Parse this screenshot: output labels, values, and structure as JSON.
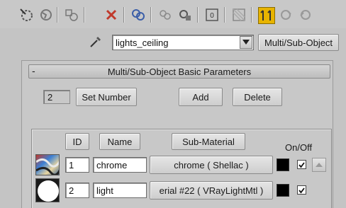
{
  "toolbar": {
    "icons": [
      "pick-material-icon",
      "get-material-icon",
      "put-to-scene-icon",
      "delete-icon",
      "assign-to-selection-icon",
      "make-unique-icon",
      "put-to-library-icon",
      "material-id-channel-icon",
      "show-map-icon",
      "show-background-icon",
      "go-to-parent-icon",
      "go-forward-icon",
      "go-sibling-icon"
    ],
    "accent": "#c0392b",
    "active_color": "#e8b400"
  },
  "material": {
    "name_value": "lights_ceiling",
    "type_label": "Multi/Sub-Object"
  },
  "rollout": {
    "title": "Multi/Sub-Object Basic Parameters",
    "collapse_glyph": "-",
    "count_value": "2",
    "set_number_label": "Set Number",
    "add_label": "Add",
    "delete_label": "Delete"
  },
  "table": {
    "headers": {
      "id": "ID",
      "name": "Name",
      "sub_material": "Sub-Material",
      "on_off": "On/Off"
    },
    "rows": [
      {
        "id": "1",
        "name": "chrome",
        "sub_material": "chrome  ( Shellac )",
        "color": "#000000",
        "on": true
      },
      {
        "id": "2",
        "name": "light",
        "sub_material": "erial #22  ( VRayLightMtl )",
        "color": "#000000",
        "on": true
      }
    ]
  }
}
